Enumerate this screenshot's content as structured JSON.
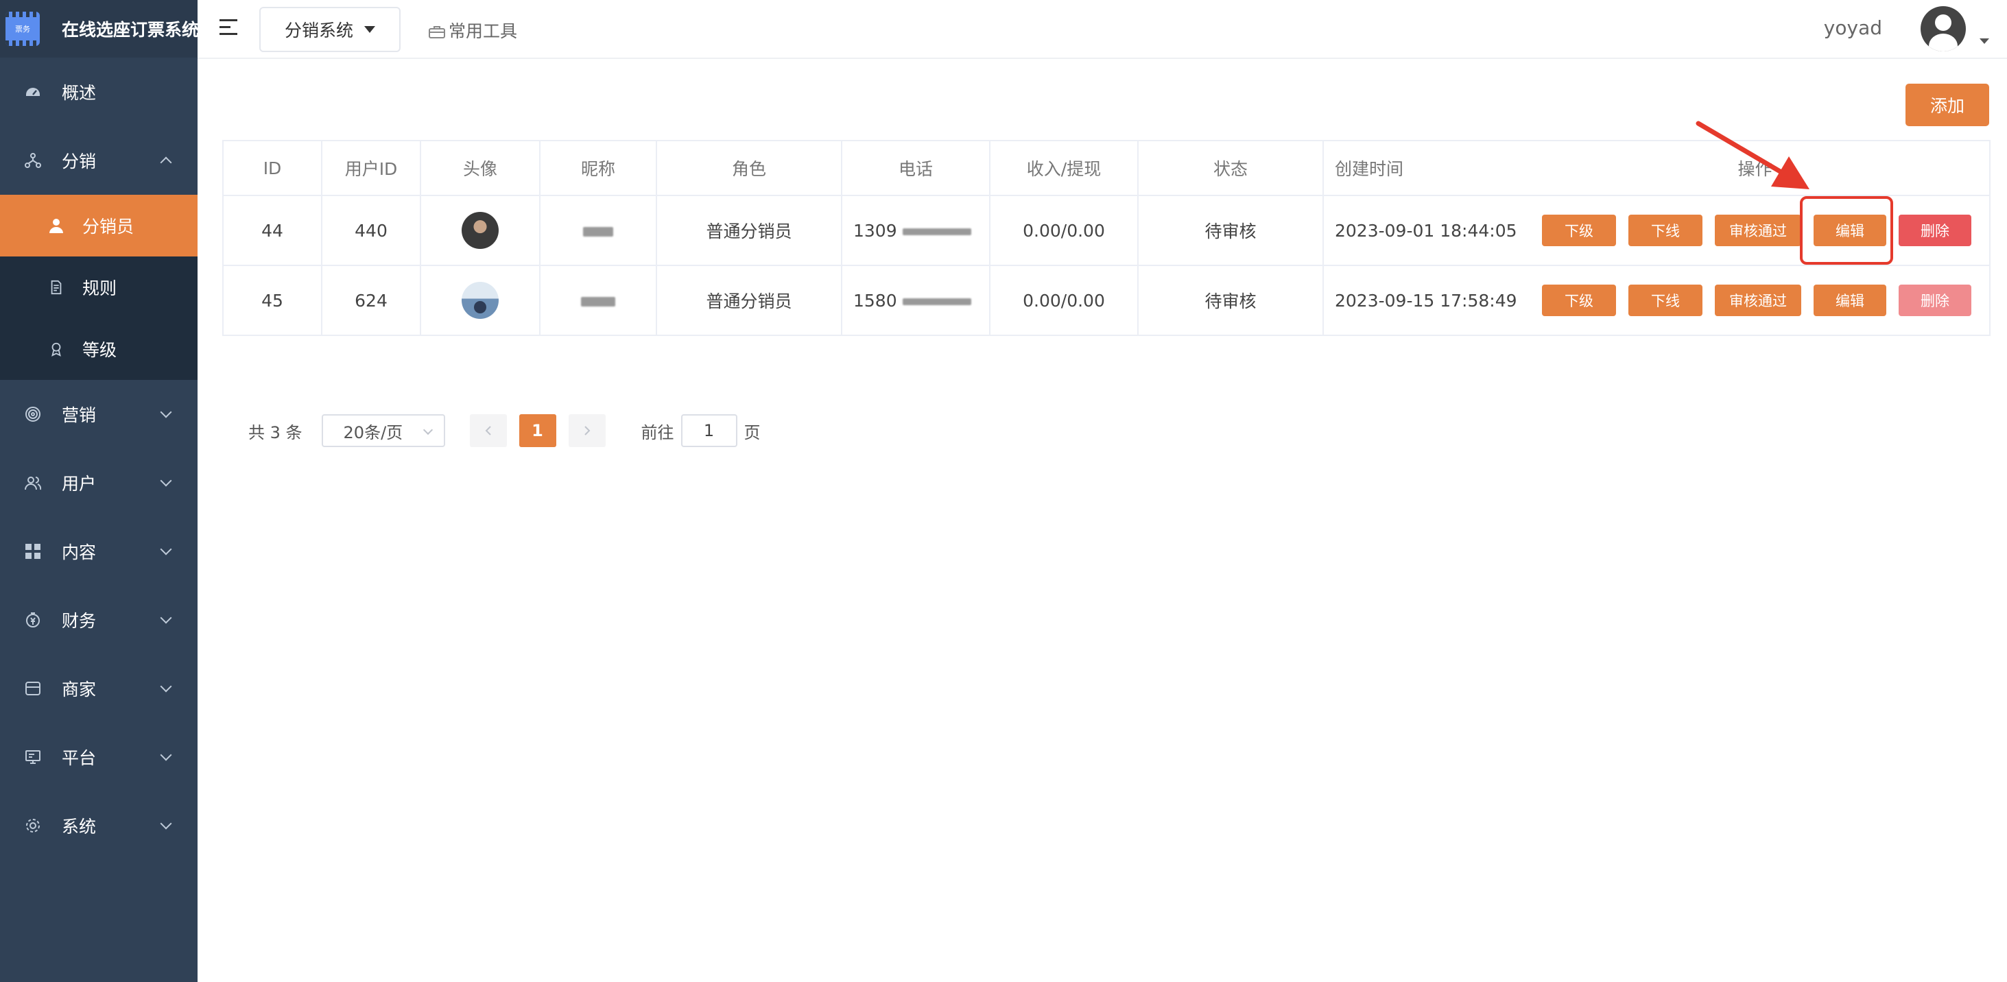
{
  "app": {
    "title": "在线选座订票系统",
    "logo_text": "票务"
  },
  "sidebar": {
    "items": [
      {
        "label": "概述",
        "icon": "dashboard-icon"
      },
      {
        "label": "分销",
        "icon": "network-icon",
        "expanded": true,
        "children": [
          {
            "label": "分销员",
            "icon": "user-icon",
            "active": true
          },
          {
            "label": "规则",
            "icon": "document-icon"
          },
          {
            "label": "等级",
            "icon": "badge-icon"
          }
        ]
      },
      {
        "label": "营销",
        "icon": "target-icon"
      },
      {
        "label": "用户",
        "icon": "users-icon"
      },
      {
        "label": "内容",
        "icon": "grid-icon"
      },
      {
        "label": "财务",
        "icon": "money-icon"
      },
      {
        "label": "商家",
        "icon": "shop-icon"
      },
      {
        "label": "平台",
        "icon": "monitor-icon"
      },
      {
        "label": "系统",
        "icon": "gear-icon"
      }
    ]
  },
  "header": {
    "system_select": "分销系统",
    "tools_label": "常用工具",
    "username": "yoyad"
  },
  "main": {
    "add_label": "添加",
    "columns": [
      "ID",
      "用户ID",
      "头像",
      "昵称",
      "角色",
      "电话",
      "收入/提现",
      "状态",
      "创建时间",
      "操作"
    ],
    "rows": [
      {
        "id": "44",
        "user_id": "440",
        "nickname": "",
        "role": "普通分销员",
        "phone": "1309",
        "income": "0.00/0.00",
        "status": "待审核",
        "created": "2023-09-01 18:44:05"
      },
      {
        "id": "45",
        "user_id": "624",
        "nickname": "",
        "role": "普通分销员",
        "phone": "1580",
        "income": "0.00/0.00",
        "status": "待审核",
        "created": "2023-09-15 17:58:49"
      }
    ],
    "actions": {
      "subordinate": "下级",
      "offline": "下线",
      "approve": "审核通过",
      "edit": "编辑",
      "delete": "删除"
    }
  },
  "pagination": {
    "total": "共 3 条",
    "page_size": "20条/页",
    "current_page": "1",
    "goto_prefix": "前往",
    "goto_value": "1",
    "goto_suffix": "页"
  },
  "colors": {
    "accent": "#e6813f",
    "danger": "#e9565a",
    "sidebar_bg": "#304156",
    "annotation": "#e53a2c"
  }
}
